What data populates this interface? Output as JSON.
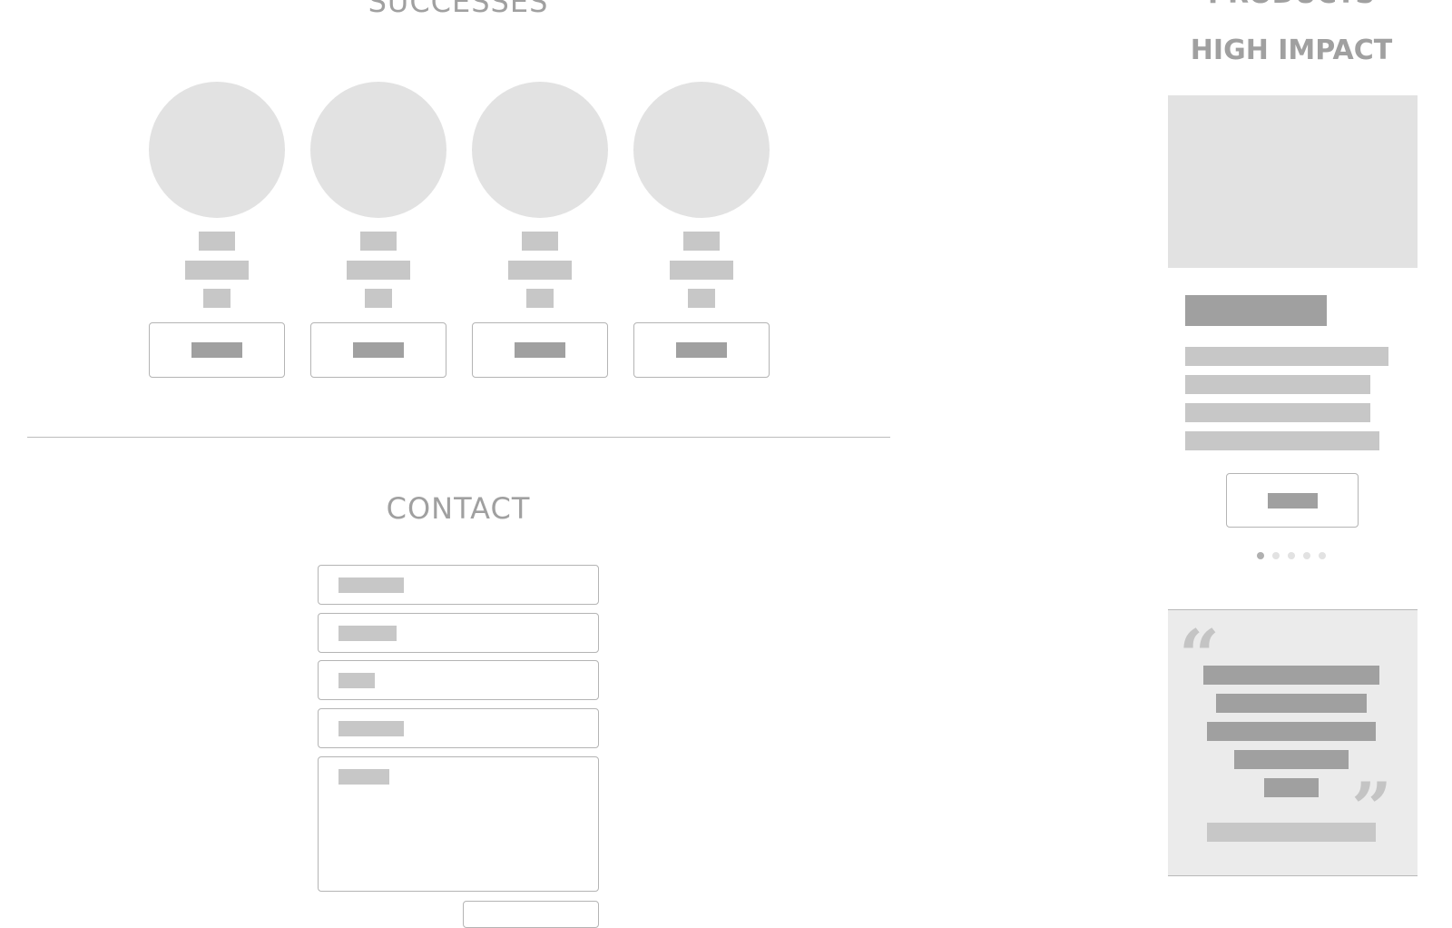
{
  "sections": {
    "successes_title": "SUCCESSES",
    "contact_title": "CONTACT",
    "products_title": "PRODUCTS",
    "high_impact_title": "HIGH IMPACT"
  },
  "carousel": {
    "slide_count": 5,
    "active_slide": 1
  },
  "quote": {
    "open_mark": "“",
    "close_mark": "”"
  }
}
